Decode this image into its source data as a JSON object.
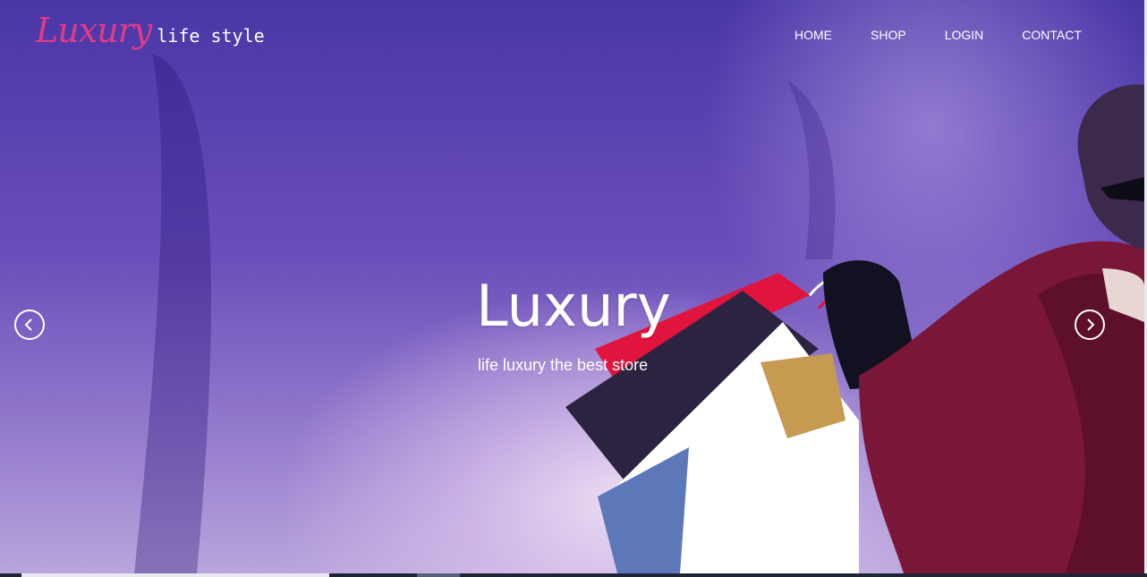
{
  "header": {
    "logo_script": "Luxury",
    "logo_text": "life style"
  },
  "nav": {
    "items": [
      "HOME",
      "SHOP",
      "LOGIN",
      "CONTACT"
    ]
  },
  "hero": {
    "title": "Luxury",
    "subtitle": "life luxury the best store",
    "prev_icon": "chevron-left-icon",
    "next_icon": "chevron-right-icon"
  },
  "colors": {
    "brand_pink": "#e33a86",
    "overlay_purple": "#5b43ad",
    "text": "#ffffff"
  }
}
